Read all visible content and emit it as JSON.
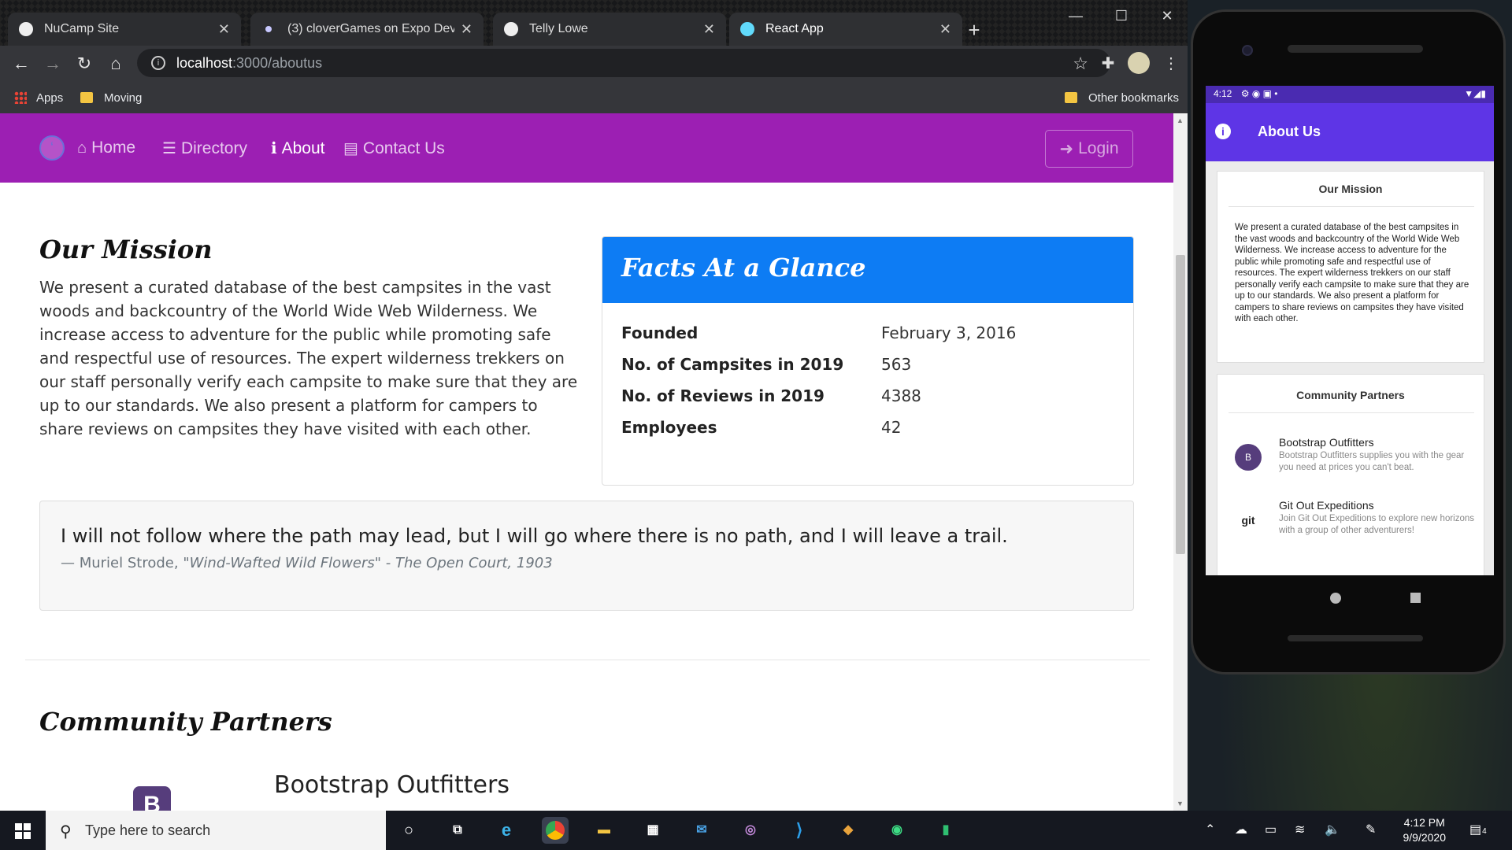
{
  "browser": {
    "tabs": [
      {
        "label": "NuCamp Site",
        "active": false
      },
      {
        "label": "(3) cloverGames on Expo Develop",
        "active": false
      },
      {
        "label": "Telly Lowe",
        "active": false
      },
      {
        "label": "React App",
        "active": true
      }
    ],
    "new_tab": "+",
    "window_controls": {
      "minimize": "—",
      "maximize": "☐",
      "close": "✕"
    },
    "url_host": "localhost",
    "url_path": ":3000/aboutus",
    "bookmarks": {
      "apps": "Apps",
      "moving": "Moving",
      "other": "Other bookmarks"
    }
  },
  "site": {
    "nav": {
      "home": "Home",
      "directory": "Directory",
      "about": "About",
      "contact": "Contact Us",
      "login": "Login"
    },
    "mission": {
      "title": "Our Mission",
      "text": "We present a curated database of the best campsites in the vast woods and backcountry of the World Wide Web Wilderness. We increase access to adventure for the public while promoting safe and respectful use of resources. The expert wilderness trekkers on our staff personally verify each campsite to make sure that they are up to our standards. We also present a platform for campers to share reviews on campsites they have visited with each other."
    },
    "facts": {
      "title": "Facts At a Glance",
      "rows": [
        {
          "label": "Founded",
          "value": "February 3, 2016"
        },
        {
          "label": "No. of Campsites in 2019",
          "value": "563"
        },
        {
          "label": "No. of Reviews in 2019",
          "value": "4388"
        },
        {
          "label": "Employees",
          "value": "42"
        }
      ]
    },
    "quote": {
      "text": "I will not follow where the path may lead, but I will go where there is no path, and I will leave a trail.",
      "author": "— Muriel Strode,",
      "work": "\"Wind-Wafted Wild Flowers\" - The Open Court, 1903"
    },
    "partners": {
      "title": "Community Partners",
      "first_name": "Bootstrap Outfitters",
      "first_logo": "B"
    }
  },
  "phone": {
    "time": "4:12",
    "app_title": "About Us",
    "mission_title": "Our Mission",
    "mission_text": "We present a curated database of the best campsites in the vast woods and backcountry of the World Wide Web Wilderness. We increase access to adventure for the public while promoting safe and respectful use of resources. The expert wilderness trekkers on our staff personally verify each campsite to make sure that they are up to our standards. We also present a platform for campers to share reviews on campsites they have visited with each other.",
    "partners_title": "Community Partners",
    "partners": [
      {
        "name": "Bootstrap Outfitters",
        "desc": "Bootstrap Outfitters supplies you with the gear you need at prices you can't beat.",
        "logo": "B"
      },
      {
        "name": "Git Out Expeditions",
        "desc": "Join Git Out Expeditions to explore new horizons with a group of other adventurers!",
        "logo": "git"
      }
    ]
  },
  "taskbar": {
    "search_placeholder": "Type here to search",
    "time": "4:12 PM",
    "date": "9/9/2020",
    "notifications": "4"
  },
  "colors": {
    "site_nav": "#9c1fb3",
    "facts_header": "#0d7cf4",
    "phone_appbar": "#5e35e6"
  }
}
